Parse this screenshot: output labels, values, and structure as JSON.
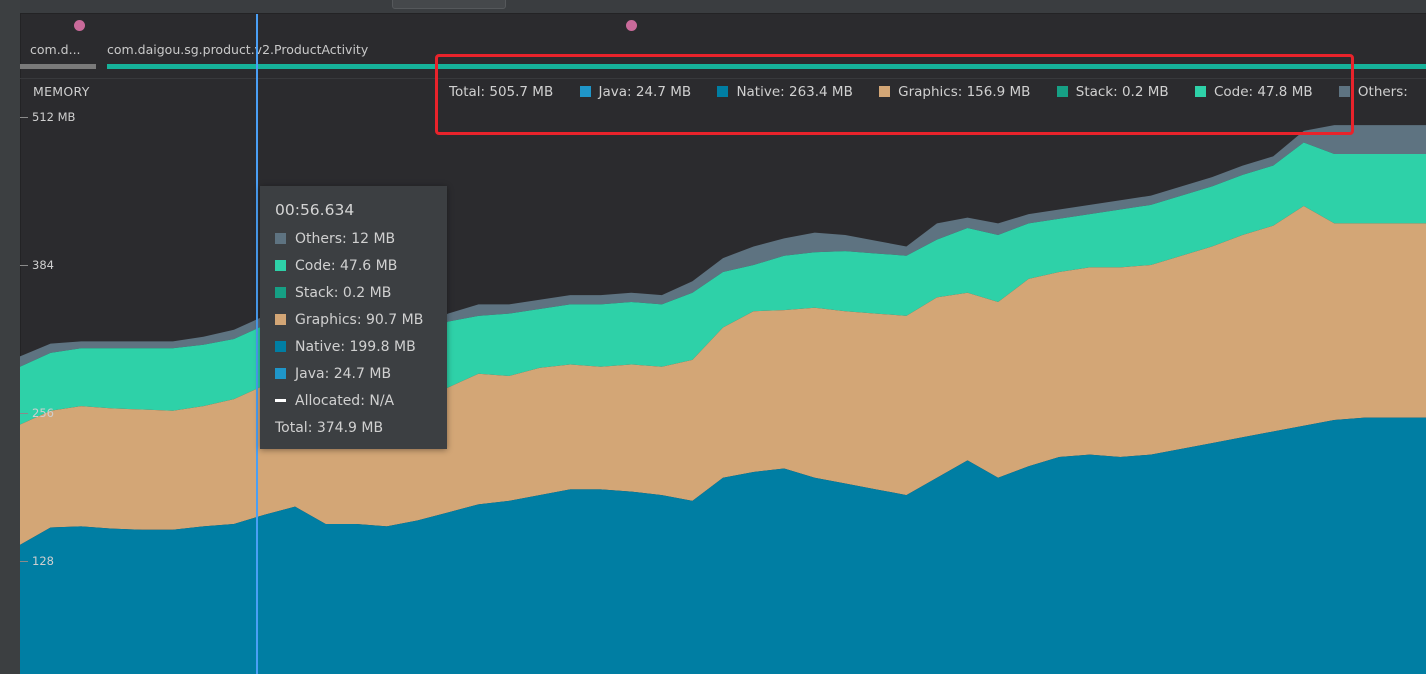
{
  "colors": {
    "java": "#1f96c9",
    "native": "#007ea3",
    "graphics": "#d3a676",
    "stack": "#16a085",
    "code": "#2ed1a8",
    "others": "#5e7381",
    "event_dot": "#c96a9a",
    "highlight": "#e8232b",
    "cursor": "#4a9ff5"
  },
  "timeline": {
    "activities": [
      {
        "label": "com.d...",
        "bar_color": "#7a7a7a"
      },
      {
        "label": "com.daigou.sg.product.v2.ProductActivity",
        "bar_color": "#16b29a"
      }
    ]
  },
  "memory": {
    "title": "MEMORY",
    "axis_labels": [
      "512 MB",
      "384",
      "256",
      "128"
    ]
  },
  "legend": {
    "total": "Total: 505.7 MB",
    "items": [
      {
        "label": "Java: 24.7 MB",
        "color_key": "java"
      },
      {
        "label": "Native: 263.4 MB",
        "color_key": "native"
      },
      {
        "label": "Graphics: 156.9 MB",
        "color_key": "graphics"
      },
      {
        "label": "Stack: 0.2 MB",
        "color_key": "stack"
      },
      {
        "label": "Code: 47.8 MB",
        "color_key": "code"
      },
      {
        "label": "Others: ",
        "color_key": "others"
      }
    ]
  },
  "tooltip": {
    "time": "00:56.634",
    "rows": [
      {
        "label": "Others: 12 MB",
        "color_key": "others"
      },
      {
        "label": "Code: 47.6 MB",
        "color_key": "code"
      },
      {
        "label": "Stack: 0.2 MB",
        "color_key": "stack"
      },
      {
        "label": "Graphics: 90.7 MB",
        "color_key": "graphics"
      },
      {
        "label": "Native: 199.8 MB",
        "color_key": "native"
      },
      {
        "label": "Java: 24.7 MB",
        "color_key": "java"
      }
    ],
    "allocated": "Allocated: N/A",
    "total": "Total: 374.9 MB"
  },
  "chart_data": {
    "type": "area",
    "ylim_mb": [
      0,
      512
    ],
    "y_ticks": [
      "512 MB",
      "384",
      "256",
      "128"
    ],
    "stacking_order": [
      "java",
      "native",
      "graphics",
      "stack",
      "code",
      "others"
    ],
    "series_points_mb": {
      "x_index": [
        0,
        1,
        2,
        3,
        4,
        5,
        6,
        7,
        8,
        9,
        10,
        11,
        12,
        13,
        14,
        15,
        16,
        17,
        18,
        19,
        20,
        21,
        22,
        23,
        24,
        25,
        26,
        27,
        28,
        29,
        30,
        31,
        32,
        33,
        34,
        35,
        36,
        37,
        38,
        39,
        40,
        41,
        42,
        43,
        44,
        45,
        46
      ],
      "native_top": [
        142,
        157,
        158,
        156,
        155,
        155,
        158,
        160,
        168,
        175,
        160,
        160,
        158,
        163,
        170,
        177,
        180,
        185,
        190,
        190,
        188,
        185,
        180,
        200,
        205,
        208,
        200,
        195,
        190,
        185,
        200,
        215,
        200,
        210,
        218,
        220,
        218,
        220,
        225,
        230,
        235,
        240,
        245,
        250,
        252,
        252,
        252
      ],
      "graphics_top": [
        246,
        258,
        262,
        260,
        259,
        258,
        262,
        268,
        280,
        302,
        262,
        262,
        262,
        264,
        278,
        290,
        288,
        295,
        298,
        296,
        298,
        296,
        302,
        330,
        344,
        345,
        347,
        344,
        342,
        340,
        356,
        360,
        352,
        372,
        378,
        382,
        382,
        384,
        392,
        400,
        410,
        418,
        435,
        420,
        420,
        420,
        420
      ],
      "code_top": [
        296,
        308,
        312,
        312,
        312,
        312,
        315,
        320,
        332,
        355,
        312,
        312,
        315,
        318,
        335,
        340,
        342,
        346,
        350,
        350,
        352,
        350,
        360,
        378,
        384,
        392,
        395,
        396,
        394,
        392,
        406,
        416,
        410,
        420,
        424,
        428,
        432,
        436,
        444,
        452,
        462,
        470,
        490,
        480,
        480,
        480,
        480
      ],
      "others_top": [
        305,
        316,
        318,
        318,
        318,
        318,
        322,
        328,
        340,
        363,
        318,
        318,
        320,
        325,
        342,
        350,
        350,
        354,
        358,
        358,
        360,
        358,
        370,
        390,
        400,
        407,
        412,
        410,
        405,
        400,
        420,
        425,
        420,
        428,
        432,
        436,
        440,
        444,
        452,
        460,
        470,
        478,
        500,
        505,
        505,
        505,
        505
      ]
    }
  }
}
